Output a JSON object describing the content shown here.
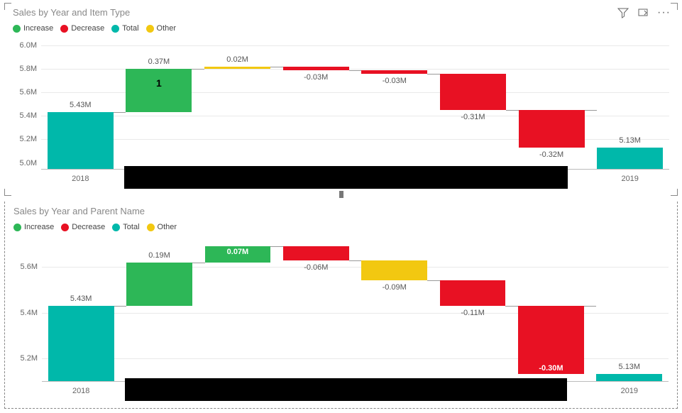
{
  "colors": {
    "increase": "#2DB757",
    "decrease": "#E81123",
    "total": "#00B8AA",
    "other": "#F2C811"
  },
  "icons": {
    "filter": "filter-icon",
    "focus": "focus-icon",
    "more": "more-icon"
  },
  "chart1": {
    "title": "Sales by Year and Item Type",
    "legend": [
      "Increase",
      "Decrease",
      "Total",
      "Other"
    ],
    "ylim": [
      4.95,
      6.0
    ],
    "yticks": [
      "6.0M",
      "5.8M",
      "5.6M",
      "5.4M",
      "5.2M",
      "5.0M"
    ],
    "xlabels": {
      "first": "2018",
      "last": "2019"
    },
    "highlight_label": "1"
  },
  "chart2": {
    "title": "Sales by Year and Parent Name",
    "legend": [
      "Increase",
      "Decrease",
      "Total",
      "Other"
    ],
    "ylim": [
      5.1,
      5.7
    ],
    "yticks": [
      "5.6M",
      "5.4M",
      "5.2M"
    ],
    "xlabels": {
      "first": "2018",
      "last": "2019"
    }
  },
  "chart_data": [
    {
      "type": "waterfall",
      "title": "Sales by Year and Item Type",
      "y_axis": {
        "min": 4.95,
        "max": 6.0,
        "unit": "M"
      },
      "bars": [
        {
          "kind": "total",
          "label": "2018",
          "value": 5.43,
          "data_label": "5.43M"
        },
        {
          "kind": "increase",
          "label": "",
          "value": 0.37,
          "data_label": "0.37M",
          "highlight": "1"
        },
        {
          "kind": "other",
          "label": "",
          "value": 0.02,
          "data_label": "0.02M"
        },
        {
          "kind": "decrease",
          "label": "",
          "value": -0.03,
          "data_label": "-0.03M"
        },
        {
          "kind": "decrease",
          "label": "",
          "value": -0.03,
          "data_label": "-0.03M"
        },
        {
          "kind": "decrease",
          "label": "",
          "value": -0.31,
          "data_label": "-0.31M"
        },
        {
          "kind": "decrease",
          "label": "",
          "value": -0.32,
          "data_label": "-0.32M"
        },
        {
          "kind": "total",
          "label": "2019",
          "value": 5.13,
          "data_label": "5.13M"
        }
      ]
    },
    {
      "type": "waterfall",
      "title": "Sales by Year and Parent Name",
      "y_axis": {
        "min": 5.1,
        "max": 5.7,
        "unit": "M"
      },
      "bars": [
        {
          "kind": "total",
          "label": "2018",
          "value": 5.43,
          "data_label": "5.43M"
        },
        {
          "kind": "increase",
          "label": "",
          "value": 0.19,
          "data_label": "0.19M"
        },
        {
          "kind": "increase",
          "label": "",
          "value": 0.07,
          "data_label": "0.07M",
          "label_inside": true
        },
        {
          "kind": "decrease",
          "label": "",
          "value": -0.06,
          "data_label": "-0.06M"
        },
        {
          "kind": "other",
          "label": "",
          "value": -0.09,
          "data_label": "-0.09M"
        },
        {
          "kind": "decrease",
          "label": "",
          "value": -0.11,
          "data_label": "-0.11M"
        },
        {
          "kind": "decrease",
          "label": "",
          "value": -0.3,
          "data_label": "-0.30M",
          "label_inside": true
        },
        {
          "kind": "total",
          "label": "2019",
          "value": 5.13,
          "data_label": "5.13M"
        }
      ]
    }
  ]
}
